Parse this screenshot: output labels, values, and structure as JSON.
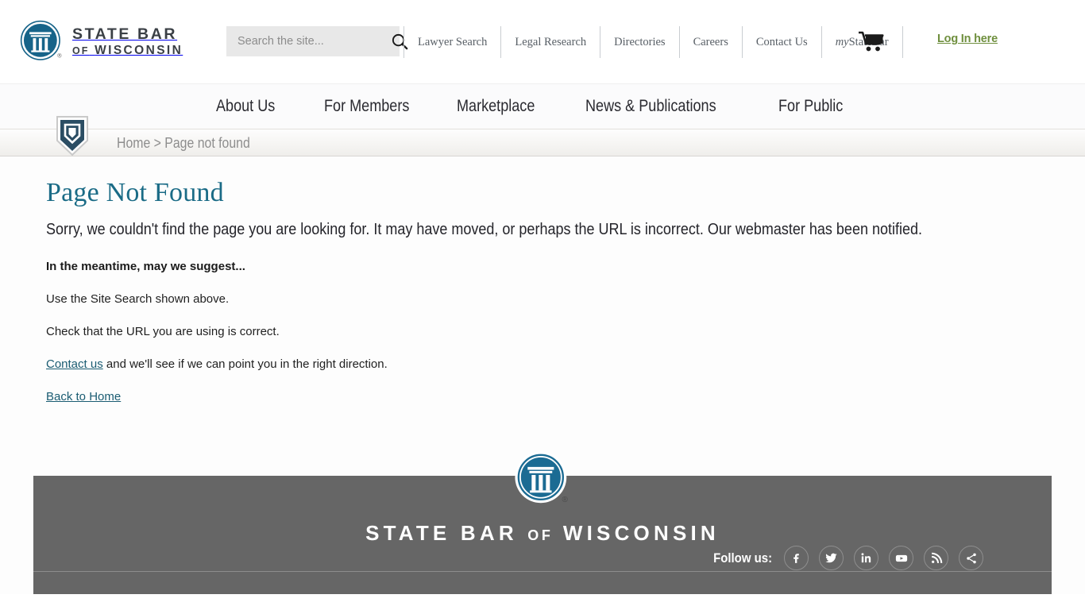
{
  "brand": {
    "logo_line1": "STATE BAR",
    "logo_line2_of": "OF",
    "logo_line2_rest": "WISCONSIN",
    "logo_icon": "state-bar-pillar-logo"
  },
  "search": {
    "placeholder": "Search the site...",
    "value": "",
    "icon": "search-icon"
  },
  "utility_nav": {
    "items": [
      {
        "label": "Lawyer Search"
      },
      {
        "label": "Legal Research"
      },
      {
        "label": "Directories"
      },
      {
        "label": "Careers"
      },
      {
        "label": "Contact Us"
      },
      {
        "label": "my StateBar",
        "italic_prefix": "my",
        "rest": " StateBar"
      }
    ],
    "cart_icon": "shopping-cart-icon",
    "login_label": "Log In here",
    "login_color": "#6f8f3e"
  },
  "main_nav": {
    "items": [
      {
        "label": "About Us"
      },
      {
        "label": "For Members"
      },
      {
        "label": "Marketplace"
      },
      {
        "label": "News & Publications"
      },
      {
        "label": "For Public"
      }
    ]
  },
  "breadcrumb": {
    "shield_icon": "shield-icon",
    "home_label": "Home",
    "separator": " > ",
    "current_label": "Page not found"
  },
  "main": {
    "title": "Page Not Found",
    "lead": "Sorry, we couldn't find the page you are looking for. It may have moved, or perhaps the URL is incorrect. Our webmaster has been notified.",
    "subhead": "In the meantime, may we suggest...",
    "suggestion_1": "Use the Site Search shown above.",
    "suggestion_2": "Check that the URL you are using is correct.",
    "contact_link": "Contact us",
    "contact_rest": " and we'll see if we can point you in the right direction.",
    "back_home_link": "Back to Home",
    "title_color": "#1a6b86",
    "link_color": "#1a5c72"
  },
  "footer": {
    "logo_icon": "state-bar-pillar-logo",
    "wordmark_1": "STATE BAR",
    "wordmark_of": "OF",
    "wordmark_2": "WISCONSIN",
    "follow_label": "Follow us:",
    "background": "#666666",
    "social": [
      {
        "name": "facebook-icon"
      },
      {
        "name": "twitter-icon"
      },
      {
        "name": "linkedin-icon"
      },
      {
        "name": "youtube-icon"
      },
      {
        "name": "rss-icon"
      },
      {
        "name": "share-icon"
      }
    ]
  }
}
